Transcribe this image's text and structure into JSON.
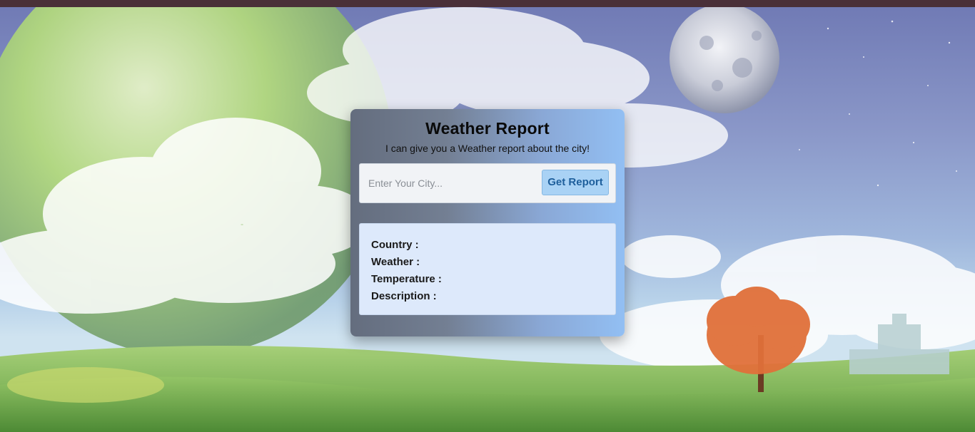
{
  "card": {
    "title": "Weather Report",
    "subtitle": "I can give you a Weather report about the city!"
  },
  "search": {
    "placeholder": "Enter Your City...",
    "value": "",
    "button_label": "Get Report"
  },
  "result": {
    "country_label": "Country :",
    "weather_label": "Weather :",
    "temperature_label": "Temperature :",
    "description_label": "Description :"
  },
  "colors": {
    "topbar": "#4a3038",
    "button_bg": "#a9d2f5",
    "button_text": "#1e5f9c",
    "result_bg": "#dde9fb"
  }
}
